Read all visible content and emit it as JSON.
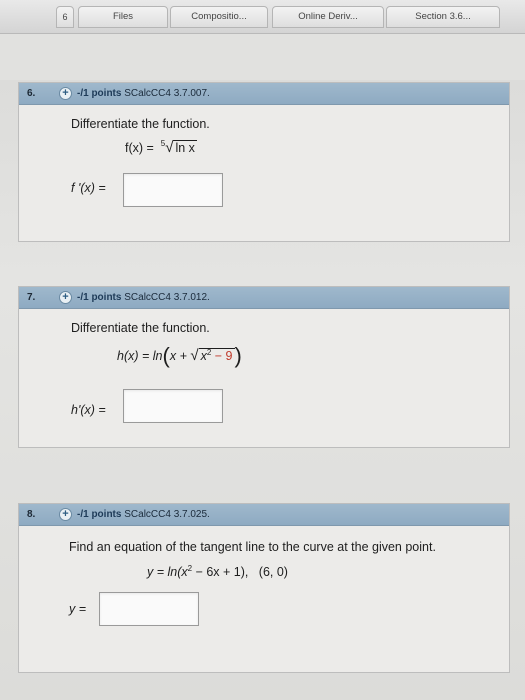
{
  "tabs": {
    "number": "6",
    "items": [
      "Files",
      "Compositio...",
      "Online Deriv...",
      "Section 3.6..."
    ]
  },
  "questions": [
    {
      "number": "6.",
      "points": "-/1 points",
      "code": "SCalcCC4 3.7.007.",
      "prompt": "Differentiate the function.",
      "fn_name": "f(x) =",
      "root_index": "5",
      "radicand": "ln x",
      "answer_label": "f '(x) ="
    },
    {
      "number": "7.",
      "points": "-/1 points",
      "code": "SCalcCC4 3.7.012.",
      "prompt": "Differentiate the function.",
      "fn_name": "h(x) = ln",
      "inner": "x +",
      "radicand": "x",
      "exp": "2",
      "rest": "− 9",
      "answer_label": "h'(x) ="
    },
    {
      "number": "8.",
      "points": "-/1 points",
      "code": "SCalcCC4 3.7.025.",
      "prompt": "Find an equation of the tangent line to the curve at the given point.",
      "eq_start": "y = ln(x",
      "exp": "2",
      "eq_mid": " − 6x + 1),",
      "point": "(6, 0)",
      "answer_label": "y ="
    }
  ]
}
